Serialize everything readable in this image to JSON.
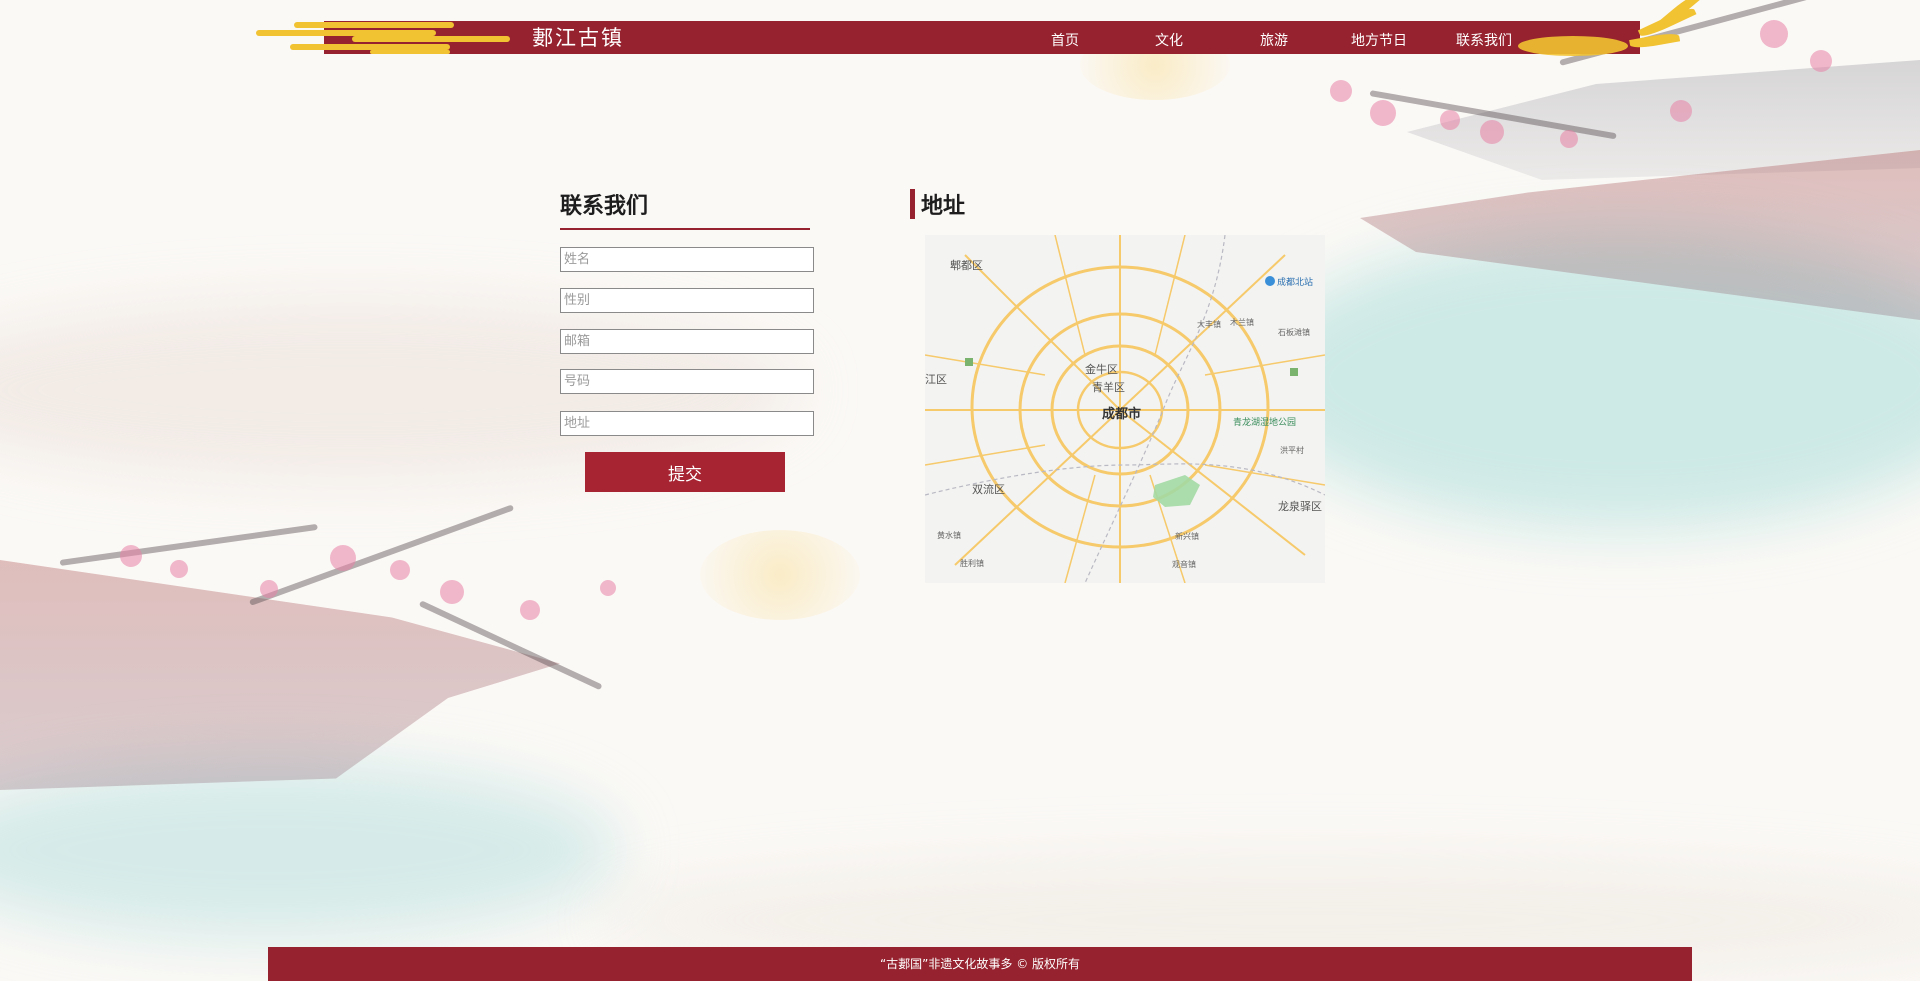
{
  "site": {
    "logo_text": "郪江古镇"
  },
  "nav": {
    "items": [
      {
        "label": "首页"
      },
      {
        "label": "文化"
      },
      {
        "label": "旅游"
      },
      {
        "label": "地方节日"
      },
      {
        "label": "联系我们"
      }
    ]
  },
  "contact": {
    "title": "联系我们",
    "fields": {
      "name_placeholder": "姓名",
      "gender_placeholder": "性别",
      "email_placeholder": "邮箱",
      "phone_placeholder": "号码",
      "address_placeholder": "地址"
    },
    "submit_label": "提交"
  },
  "address": {
    "title": "地址",
    "map": {
      "city": "成都市",
      "labels": {
        "pidu": "郫都区",
        "north_station": "成都北站",
        "jinniu": "金牛区",
        "qingyang": "青羊区",
        "wenjiang": "江区",
        "shuangliu": "双流区",
        "longquanyi": "龙泉驿区",
        "qinglonghu": "青龙湖湿地公园",
        "shiling": "石板滩镇",
        "dafeng": "大丰镇",
        "muzhen": "木兰镇",
        "xingxing": "黄水镇",
        "xinxing": "新兴镇",
        "guanyin": "观音镇",
        "liuba": "胜利镇",
        "jiangping": "洪平村"
      }
    }
  },
  "footer": {
    "text": "“古郪国”非遗文化故事多 © 版权所有"
  },
  "colors": {
    "brand_red": "#95222e",
    "button_red": "#a72433",
    "accent_gold": "#f1c232"
  }
}
